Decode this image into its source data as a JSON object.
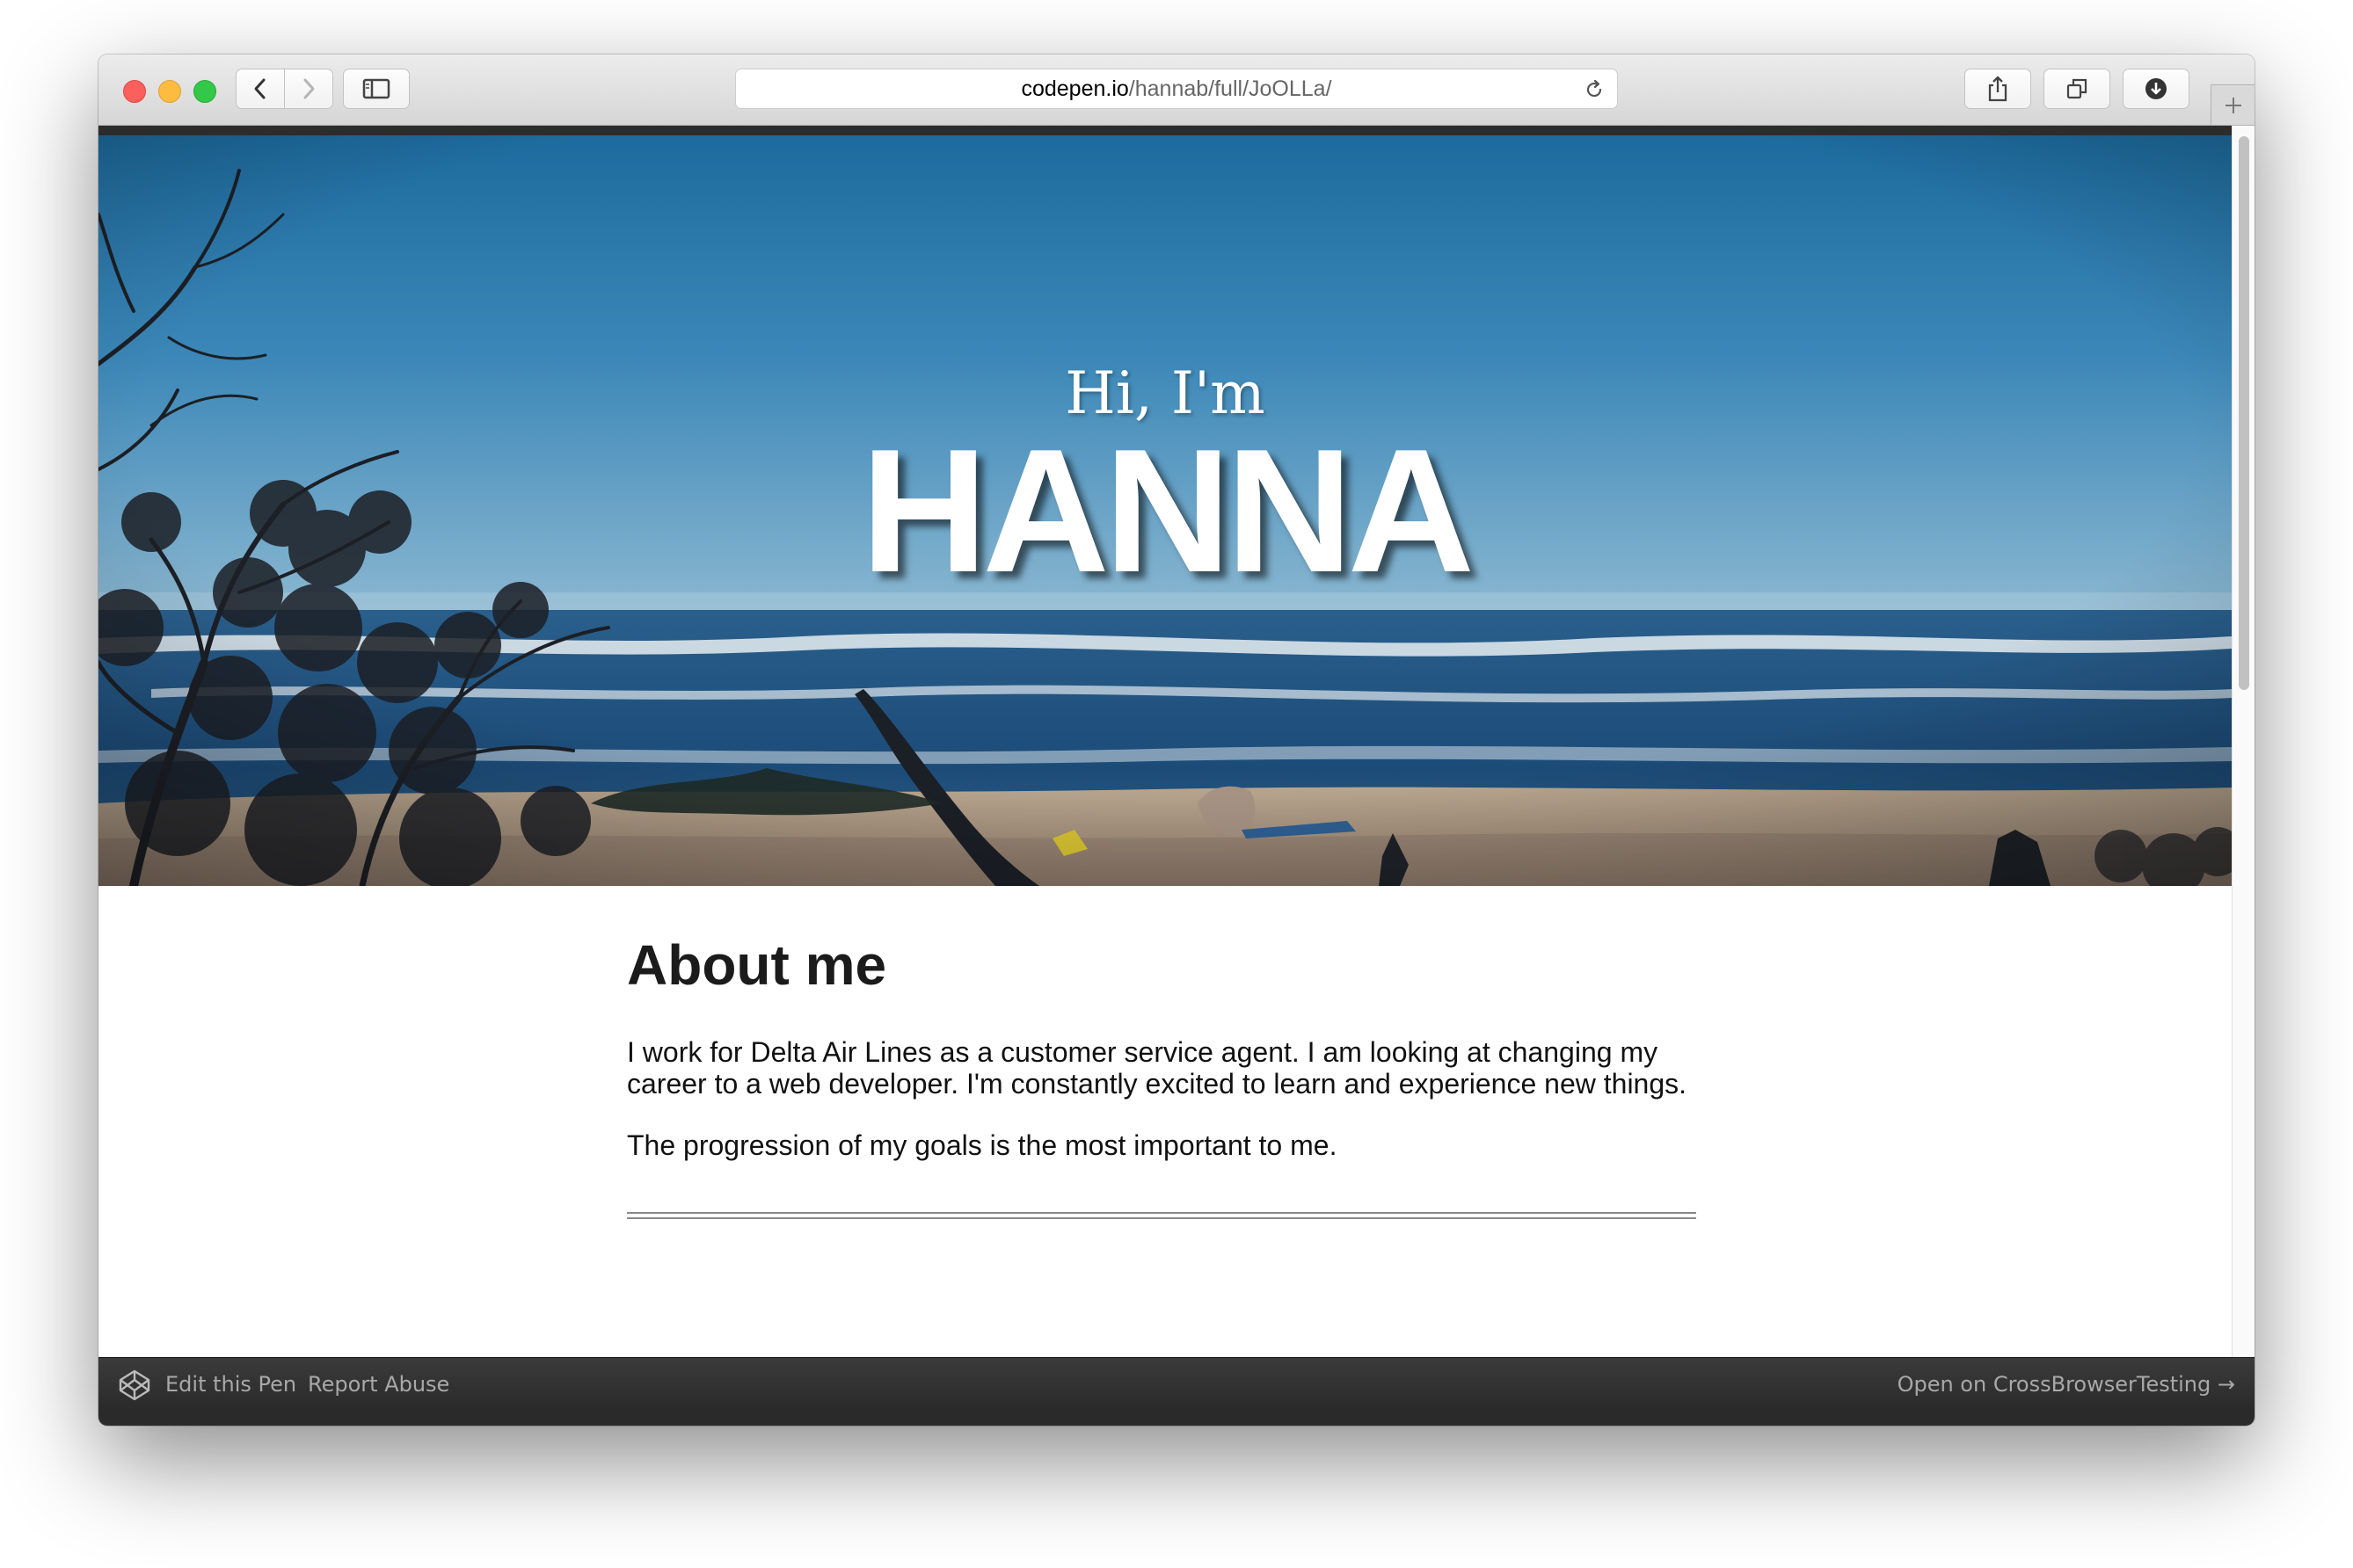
{
  "browser": {
    "url_host": "codepen.io",
    "url_path": "/hannab/full/JoOLLa/",
    "buttons": {
      "back": "chevron-left-icon",
      "forward": "chevron-right-icon",
      "sidebar": "sidebar-icon",
      "reload": "reload-icon",
      "share": "share-icon",
      "tabs": "tabs-overview-icon",
      "download": "download-icon",
      "new_tab": "plus-icon"
    }
  },
  "hero": {
    "greeting": "Hi, I'm",
    "name": "HANNA"
  },
  "about": {
    "heading": "About me",
    "paragraph1": "I work for Delta Air Lines as a customer service agent. I am looking at changing my career to a web developer. I'm constantly excited to learn and experience new things.",
    "paragraph2": "The progression of my goals is the most important to me."
  },
  "footer": {
    "edit_label": "Edit this Pen",
    "report_label": "Report Abuse",
    "crossbrowser_label": "Open on CrossBrowserTesting →"
  },
  "colors": {
    "sky": "#2e7bb0",
    "sea": "#1e4f7a",
    "sand": "#b7a48c",
    "footer_bg": "#333333",
    "footer_text": "#a8a8a8"
  }
}
